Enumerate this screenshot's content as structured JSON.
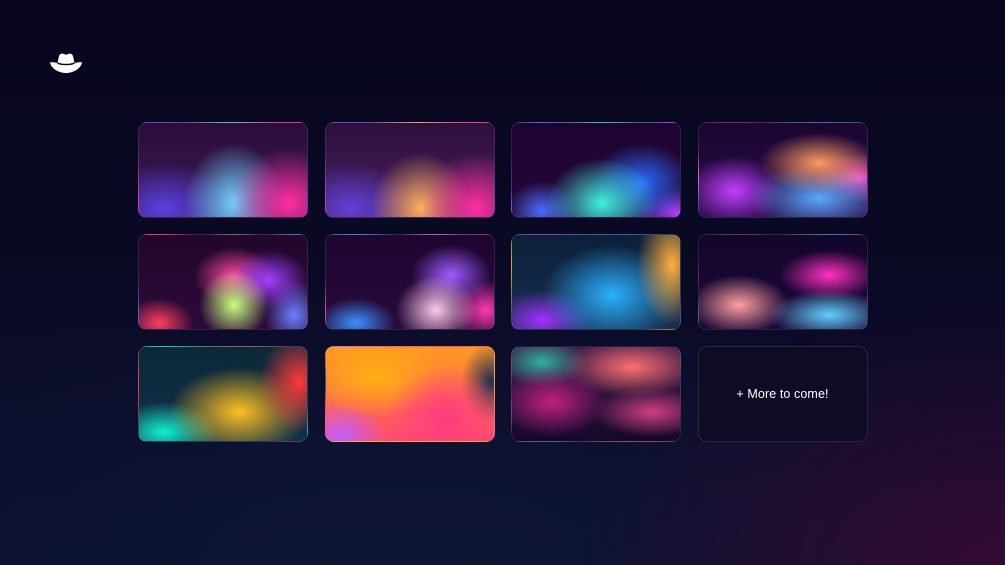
{
  "brand": {
    "logo_icon": "cowboy-hat-icon"
  },
  "gallery": {
    "tiles": [
      {
        "name": "gradient-1"
      },
      {
        "name": "gradient-2"
      },
      {
        "name": "gradient-3"
      },
      {
        "name": "gradient-4"
      },
      {
        "name": "gradient-5"
      },
      {
        "name": "gradient-6"
      },
      {
        "name": "gradient-7"
      },
      {
        "name": "gradient-8"
      },
      {
        "name": "gradient-9"
      },
      {
        "name": "gradient-10"
      },
      {
        "name": "gradient-11"
      }
    ],
    "more_label": "+ More to come!"
  },
  "colors": {
    "background": "#08061e",
    "tile_border": "rgba(255,255,255,0.10)",
    "text": "#ffffff"
  }
}
